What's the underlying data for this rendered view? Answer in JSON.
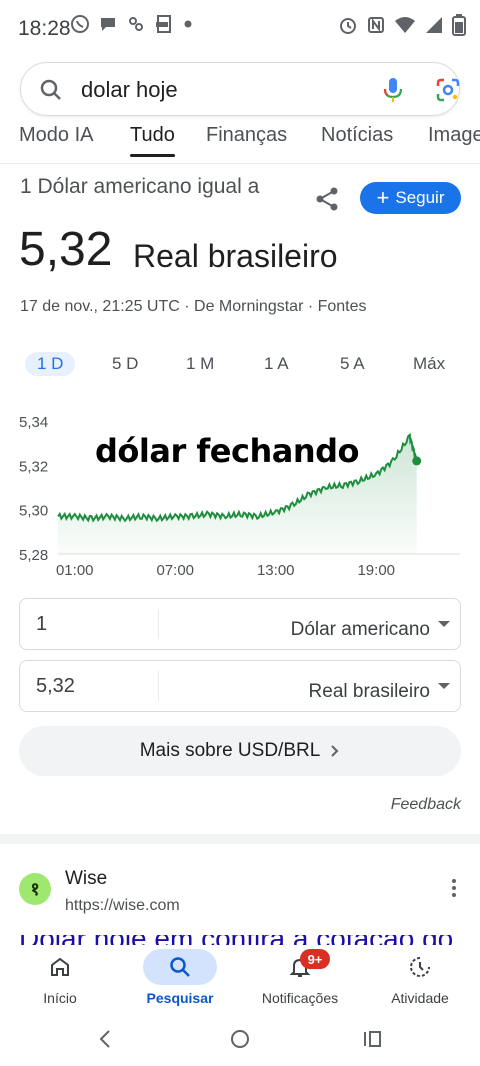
{
  "status_bar": {
    "time": "18:28",
    "icons": [
      "whatsapp-icon",
      "chat-icon",
      "link-icon",
      "pdf-icon",
      "dot-icon",
      "alarm-icon",
      "nfc-icon",
      "wifi-icon",
      "signal-icon",
      "battery-icon"
    ]
  },
  "search": {
    "query": "dolar hoje"
  },
  "tabs": [
    "Modo IA",
    "Tudo",
    "Finanças",
    "Notícias",
    "Imagens"
  ],
  "active_tab": "Tudo",
  "converter": {
    "title": "1 Dólar americano igual a",
    "follow_label": "Seguir",
    "value": "5,32",
    "unit": "Real brasileiro",
    "meta": "17 de nov., 21:25 UTC · De Morningstar · Fontes"
  },
  "ranges": [
    "1 D",
    "5 D",
    "1 M",
    "1 A",
    "5 A",
    "Máx"
  ],
  "active_range": "1 D",
  "overlay_caption": "dólar fechando",
  "chart_data": {
    "type": "area",
    "y_tick_labels": [
      "5,34",
      "5,32",
      "5,30",
      "5,28"
    ],
    "x_tick_labels": [
      "01:00",
      "07:00",
      "13:00",
      "19:00"
    ],
    "ylim": [
      5.28,
      5.34
    ],
    "x": [
      "00:00",
      "01:00",
      "02:00",
      "03:00",
      "04:00",
      "05:00",
      "06:00",
      "07:00",
      "08:00",
      "09:00",
      "10:00",
      "11:00",
      "12:00",
      "13:00",
      "14:00",
      "15:00",
      "16:00",
      "17:00",
      "18:00",
      "19:00",
      "20:00",
      "21:00",
      "21:25"
    ],
    "values": [
      5.297,
      5.297,
      5.296,
      5.297,
      5.296,
      5.297,
      5.296,
      5.297,
      5.297,
      5.298,
      5.297,
      5.298,
      5.297,
      5.299,
      5.302,
      5.307,
      5.31,
      5.311,
      5.313,
      5.316,
      5.322,
      5.333,
      5.322
    ],
    "color": "#1e8e3e",
    "grid": false
  },
  "inputs": {
    "from_amount": "1",
    "from_currency": "Dólar americano",
    "to_amount": "5,32",
    "to_currency": "Real brasileiro"
  },
  "more_button": "Mais sobre USD/BRL",
  "feedback": "Feedback",
  "result": {
    "logo_glyph": "१",
    "name": "Wise",
    "url": "https://wise.com",
    "title_cut": "Dólar hoje em confira a cotação do dólar"
  },
  "bottom_nav": {
    "items": [
      {
        "label": "Início",
        "icon": "home-icon"
      },
      {
        "label": "Pesquisar",
        "icon": "search-icon"
      },
      {
        "label": "Notificações",
        "icon": "bell-icon"
      },
      {
        "label": "Atividade",
        "icon": "activity-icon"
      }
    ],
    "badge": "9+",
    "active": "Pesquisar"
  },
  "colors": {
    "accent": "#1a73e8",
    "chart_line": "#1e8e3e",
    "badge": "#d93025"
  }
}
